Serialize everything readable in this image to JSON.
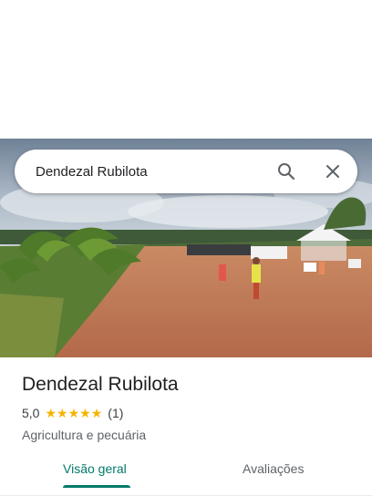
{
  "search": {
    "value": "Dendezal Rubilota",
    "search_icon": "search-icon",
    "close_icon": "close-icon"
  },
  "place": {
    "name": "Dendezal Rubilota",
    "rating": "5,0",
    "stars": 5,
    "reviews_count": "(1)",
    "category": "Agricultura e pecuária"
  },
  "tabs": [
    {
      "label": "Visão geral",
      "active": true
    },
    {
      "label": "Avaliações",
      "active": false
    }
  ],
  "colors": {
    "accent": "#00796b",
    "star": "#f5b400"
  }
}
